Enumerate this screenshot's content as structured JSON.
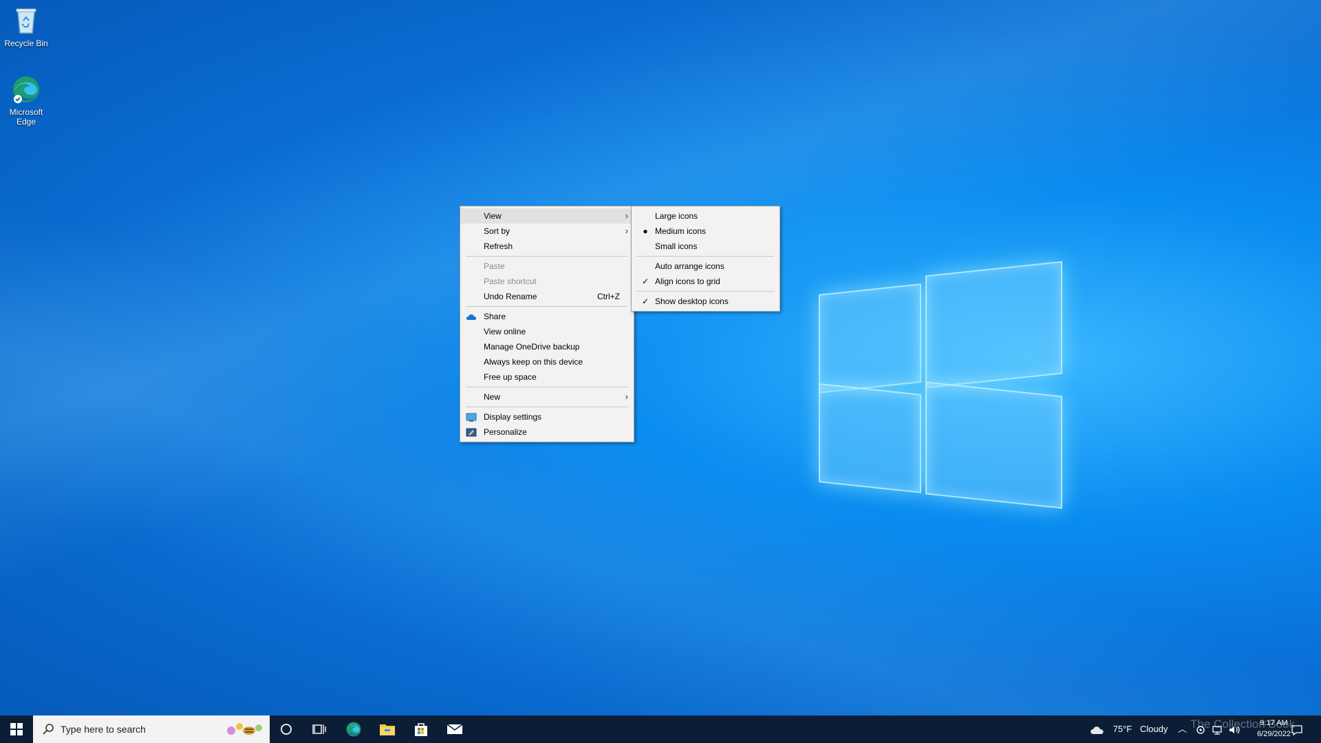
{
  "desktop": {
    "icons": [
      {
        "label": "Recycle Bin"
      },
      {
        "label": "Microsoft Edge"
      }
    ]
  },
  "context_menu": {
    "items": [
      {
        "label": "View"
      },
      {
        "label": "Sort by"
      },
      {
        "label": "Refresh"
      },
      {
        "label": "Paste"
      },
      {
        "label": "Paste shortcut"
      },
      {
        "label": "Undo Rename",
        "shortcut": "Ctrl+Z"
      },
      {
        "label": "Share"
      },
      {
        "label": "View online"
      },
      {
        "label": "Manage OneDrive backup"
      },
      {
        "label": "Always keep on this device"
      },
      {
        "label": "Free up space"
      },
      {
        "label": "New"
      },
      {
        "label": "Display settings"
      },
      {
        "label": "Personalize"
      }
    ]
  },
  "view_submenu": {
    "items": [
      {
        "label": "Large icons"
      },
      {
        "label": "Medium icons",
        "mark": "●"
      },
      {
        "label": "Small icons"
      },
      {
        "label": "Auto arrange icons"
      },
      {
        "label": "Align icons to grid",
        "mark": "✓"
      },
      {
        "label": "Show desktop icons",
        "mark": "✓"
      }
    ]
  },
  "taskbar": {
    "search_placeholder": "Type here to search",
    "weather": {
      "temp": "75°F",
      "condition": "Cloudy"
    },
    "clock": {
      "time": "9:17 AM",
      "date": "6/29/2022"
    }
  },
  "watermark": "The Collection Book",
  "colors": {
    "taskbar": "#0c1e35",
    "menu_bg": "#f2f2f2",
    "highlight": "#e1e1e1",
    "accent": "#0078d7"
  }
}
